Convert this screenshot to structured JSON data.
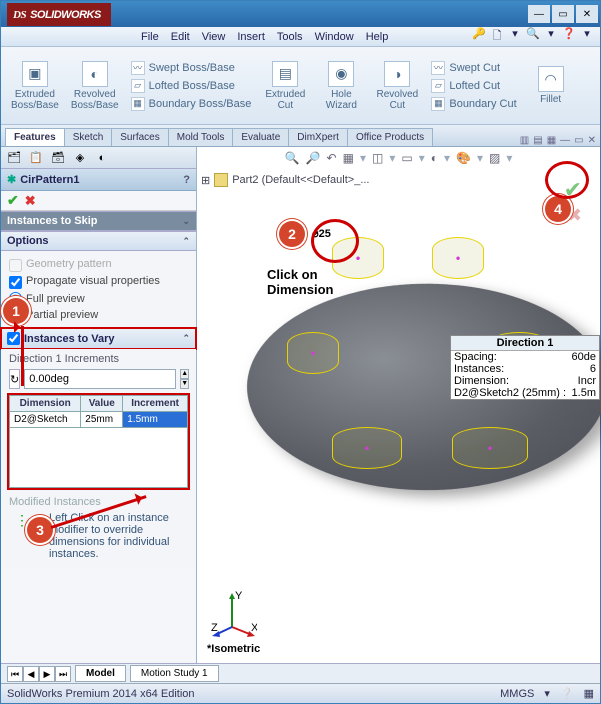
{
  "app": {
    "vendor_prefix": "DS",
    "name": "SOLIDWORKS"
  },
  "menu": [
    "File",
    "Edit",
    "View",
    "Insert",
    "Tools",
    "Window",
    "Help"
  ],
  "quick_icons": [
    "🔑",
    "🗋",
    "▾",
    "🔍",
    "▾",
    "❓",
    "▾"
  ],
  "ribbon": {
    "big": [
      {
        "label": "Extruded\nBoss/Base"
      },
      {
        "label": "Revolved\nBoss/Base"
      }
    ],
    "boss_list": [
      "Swept Boss/Base",
      "Lofted Boss/Base",
      "Boundary Boss/Base"
    ],
    "cut_big": [
      {
        "label": "Extruded\nCut"
      },
      {
        "label": "Hole\nWizard"
      },
      {
        "label": "Revolved\nCut"
      }
    ],
    "cut_list": [
      "Swept Cut",
      "Lofted Cut",
      "Boundary Cut"
    ],
    "fillet": "Fillet"
  },
  "cmd_tabs": [
    "Features",
    "Sketch",
    "Surfaces",
    "Mold Tools",
    "Evaluate",
    "DimXpert",
    "Office Products"
  ],
  "feature_mgr": {
    "title": "CirPattern1",
    "skip_hdr": "Instances to Skip",
    "options_hdr": "Options",
    "geom_pattern": "Geometry pattern",
    "propagate": "Propagate visual properties",
    "full_preview": "Full preview",
    "partial_preview": "Partial preview",
    "instances_vary_hdr": "Instances to Vary",
    "dir1_incr": "Direction 1 Increments",
    "angle_value": "0.00deg",
    "table": {
      "headers": [
        "Dimension",
        "Value",
        "Increment"
      ],
      "row": [
        "D2@Sketch",
        "25mm",
        "1.5mm"
      ]
    },
    "modified_hdr": "Modified Instances",
    "mod_help": "Left Click on an instance modifier to override dimensions for individual instances."
  },
  "viewport": {
    "tree_node": "Part2  (Default<<Default>_...",
    "iso_label": "*Isometric",
    "click_txt": "Click on\nDimension",
    "dim_flag": "25",
    "dir_box": {
      "title": "Direction 1",
      "rows": [
        [
          "Spacing:",
          "60de"
        ],
        [
          "Instances:",
          "6"
        ],
        [
          "Dimension:",
          "Incr"
        ],
        [
          "D2@Sketch2 (25mm) :",
          "1.5m"
        ]
      ]
    }
  },
  "bottom_tabs": [
    "Model",
    "Motion Study 1"
  ],
  "status": {
    "left": "SolidWorks Premium 2014 x64 Edition",
    "units": "MMGS"
  },
  "callouts": {
    "c1": "1",
    "c2": "2",
    "c3": "3",
    "c4": "4"
  }
}
